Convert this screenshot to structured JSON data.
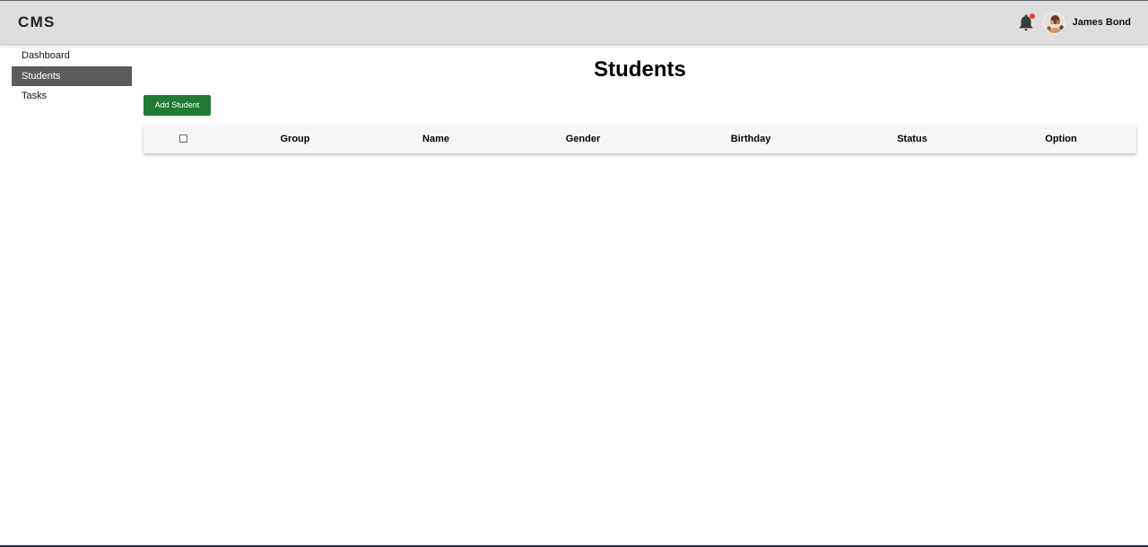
{
  "header": {
    "brand": "CMS",
    "user_name": "James Bond",
    "bell_icon": "bell-icon",
    "avatar_icon": "avatar-icon",
    "notification_color": "#e53935"
  },
  "sidebar": {
    "items": [
      {
        "label": "Dashboard",
        "active": false
      },
      {
        "label": "Students",
        "active": true
      },
      {
        "label": "Tasks",
        "active": false
      }
    ],
    "active_color": "#5c5c5c"
  },
  "main": {
    "title": "Students",
    "add_button": "Add Student",
    "button_color": "#1f7a34",
    "table": {
      "headers": [
        "",
        "Group",
        "Name",
        "Gender",
        "Birthday",
        "Status",
        "Option"
      ],
      "rows": []
    }
  }
}
